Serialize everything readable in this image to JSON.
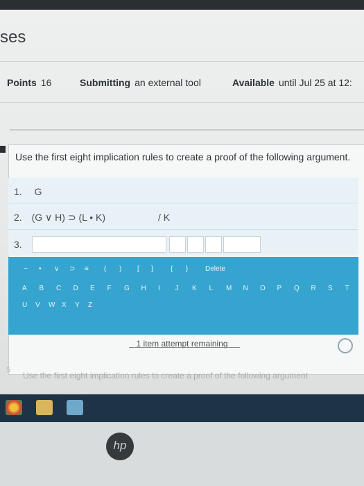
{
  "page": {
    "section_title": "ses"
  },
  "meta": {
    "points_label": "Points",
    "points_value": "16",
    "submitting_label": "Submitting",
    "submitting_value": "an external tool",
    "available_label": "Available",
    "available_value": "until Jul 25 at 12:"
  },
  "question": {
    "prompt": "Use the first eight implication rules to create a proof of the following argument.",
    "lines": [
      {
        "num": "1.",
        "text": "G"
      },
      {
        "num": "2.",
        "text": "(G ∨ H) ⊃ (L • K)"
      },
      {
        "num": "3.",
        "text": ""
      }
    ],
    "conclusion": "/ K"
  },
  "keyboard": {
    "symbols": [
      "~",
      "•",
      "∨",
      "⊃",
      "≡",
      "(",
      ")",
      "[",
      "]",
      "{",
      "}"
    ],
    "delete_label": "Delete",
    "letters_row1": [
      "A",
      "B",
      "C",
      "D",
      "E",
      "F",
      "G",
      "H",
      "I",
      "J",
      "K",
      "L",
      "M",
      "N",
      "O",
      "P",
      "Q",
      "R",
      "S",
      "T"
    ],
    "letters_row2": [
      "U",
      "V",
      "W",
      "X",
      "Y",
      "Z"
    ]
  },
  "attempts": {
    "text": "1 item attempt remaining"
  },
  "next_question": {
    "num": "5",
    "prompt": "Use the first eight implication rules to create a proof of the following argument"
  },
  "brand": {
    "logo_text": "hp"
  },
  "colors": {
    "keyboard_bg": "#35a4cf",
    "proof_bg": "#e7f1f6",
    "taskbar": "#1e3346"
  }
}
